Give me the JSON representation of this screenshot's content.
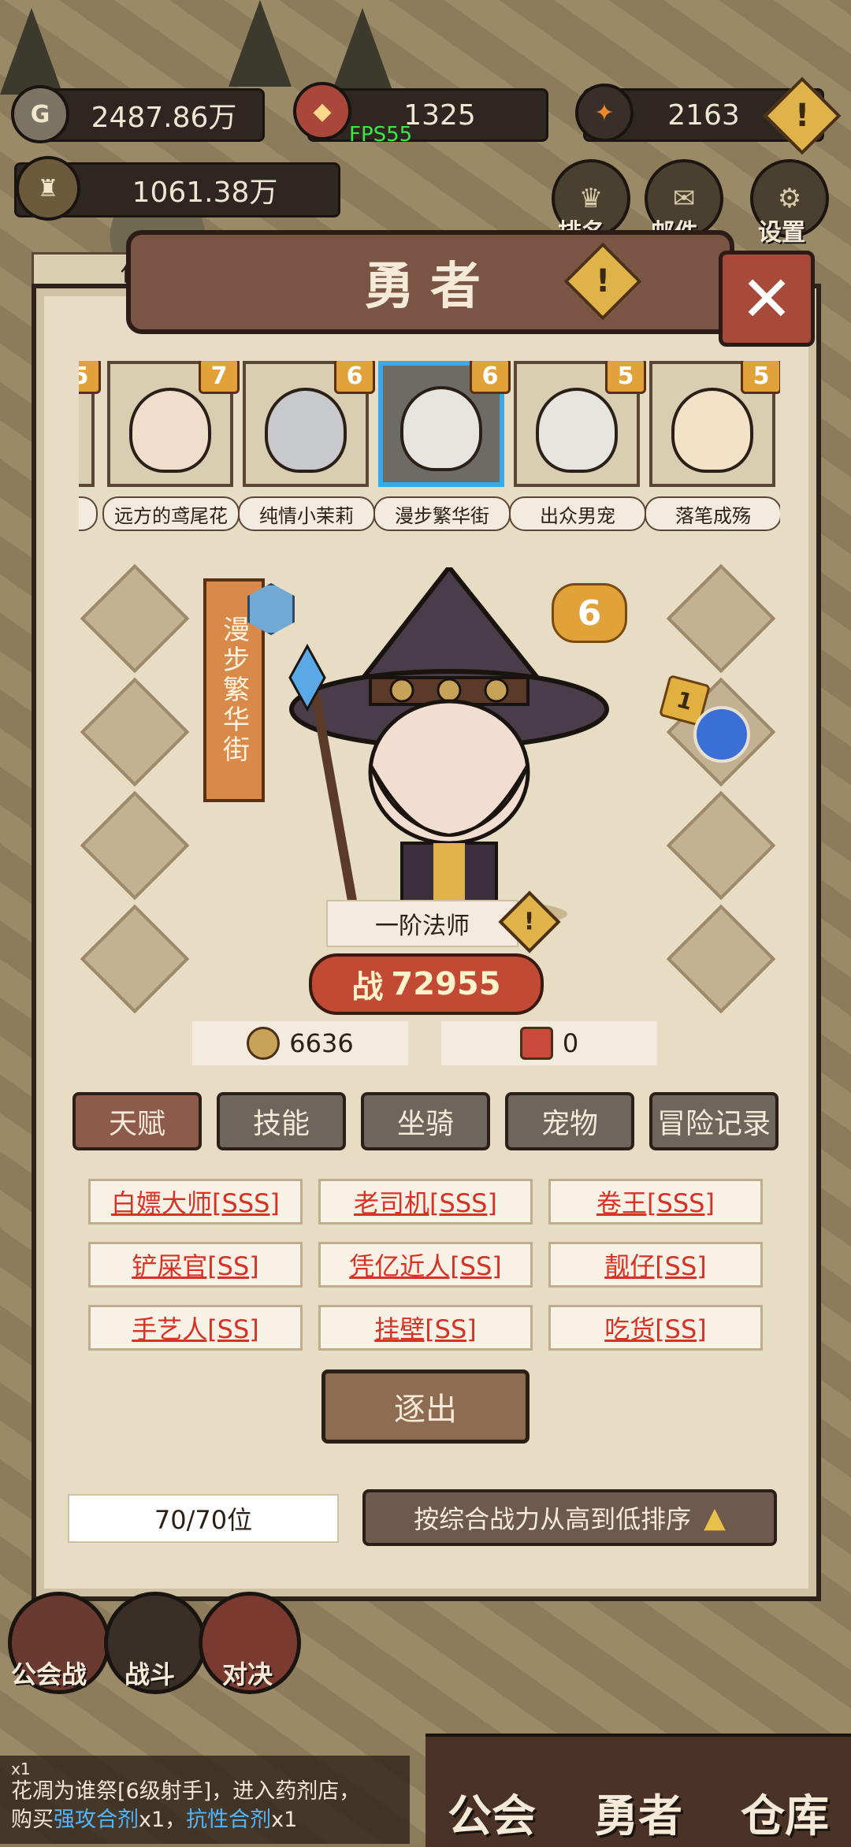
{
  "resources": {
    "gold": "2487.86万",
    "power": "1325",
    "gem": "2163",
    "total": "1061.38万"
  },
  "fps": "FPS55",
  "top_buttons": [
    {
      "label": "排名"
    },
    {
      "label": "邮件"
    },
    {
      "label": "设置"
    }
  ],
  "behind_text": "任意",
  "panel": {
    "title": "勇者",
    "heroes": [
      {
        "name": "伤",
        "level": "5"
      },
      {
        "name": "远方的鸢尾花",
        "level": "7"
      },
      {
        "name": "纯情小茉莉",
        "level": "6"
      },
      {
        "name": "漫步繁华街",
        "level": "6"
      },
      {
        "name": "出众男宠",
        "level": "5"
      },
      {
        "name": "落笔成殇",
        "level": "5"
      }
    ],
    "selected": {
      "name": "漫步繁华街",
      "star": "6",
      "badge_level": "1",
      "class_title": "一阶法师",
      "combat_label": "战",
      "combat_power": "72955",
      "coins": "6636",
      "tickets": "0"
    },
    "tabs": [
      "天赋",
      "技能",
      "坐骑",
      "宠物",
      "冒险记录"
    ],
    "talents": [
      "白嫖大师[SSS]",
      "老司机[SSS]",
      "卷王[SSS]",
      "铲屎官[SS]",
      "凭亿近人[SS]",
      "靓仔[SS]",
      "手艺人[SS]",
      "挂壁[SS]",
      "吃货[SS]"
    ],
    "expel_button": "逐出",
    "capacity": "70/70位",
    "sort_button": "按综合战力从高到低排序"
  },
  "bottom": {
    "nav_left": [
      "公会战",
      "战斗",
      "对决"
    ],
    "nav_right": [
      "公会",
      "勇者",
      "仓库"
    ],
    "log": {
      "count": "x1",
      "line1": "花凋为谁祭[6级射手]，进入药剂店，",
      "line2_prefix": "购买",
      "item1": "强攻合剂",
      "mid": "x1，",
      "item2": "抗性合剂",
      "suffix": "x1"
    }
  },
  "colors": {
    "accent_selected": "#39a9e8",
    "talent_text": "#d63326",
    "panel_bg": "#e7dcc4"
  }
}
